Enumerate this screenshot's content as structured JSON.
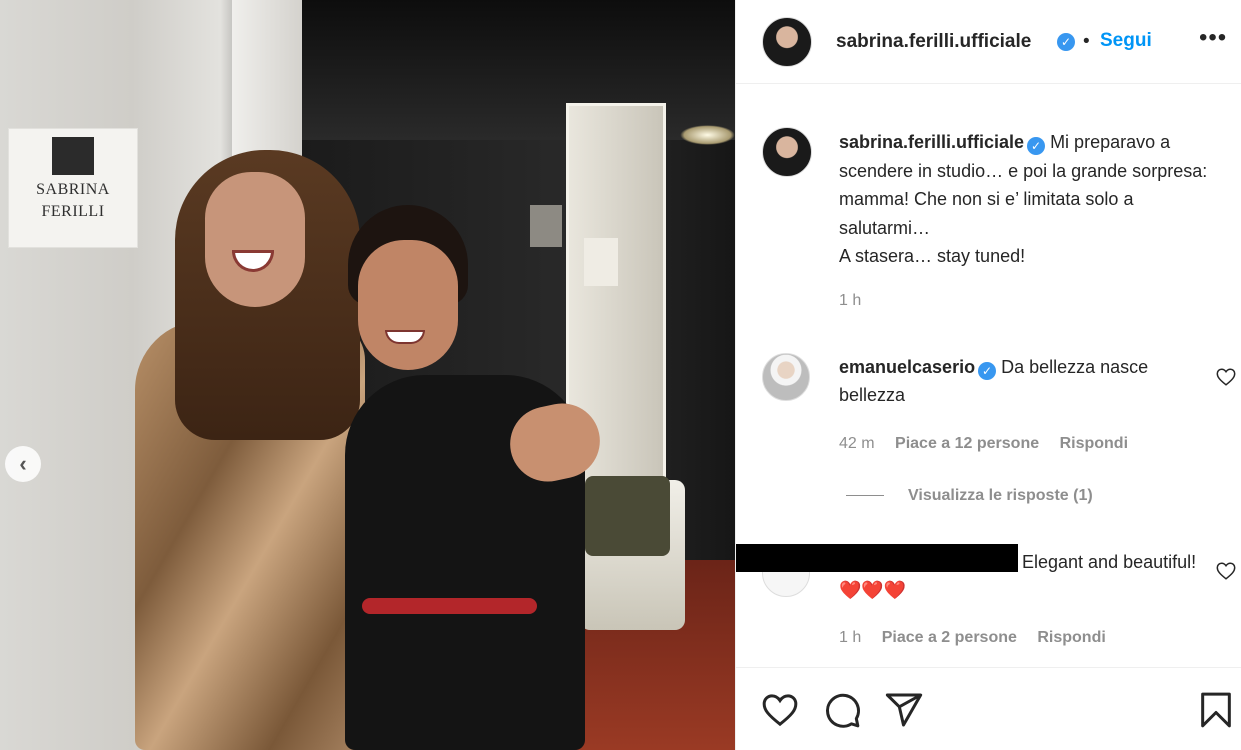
{
  "photo": {
    "nameplate_lines": [
      "SABRINA",
      "FERILLI"
    ],
    "prev_glyph": "‹"
  },
  "post": {
    "username": "sabrina.ferilli.ufficiale",
    "separator": "•",
    "follow_label": "Segui",
    "more_glyph": "•••",
    "verified_glyph": "✓"
  },
  "caption": {
    "username": "sabrina.ferilli.ufficiale",
    "text_line1": " Mi preparavo a scendere in studio… e poi la grande sorpresa: mamma! Che non si e’ limitata solo a salutarmi…",
    "text_line2": "A stasera… stay tuned!",
    "time": "1 h"
  },
  "comments": [
    {
      "username": "emanuelcaserio",
      "text": " Da bellezza nasce bellezza",
      "time": "42 m",
      "likes": "Piace a 12 persone",
      "reply": "Rispondi"
    },
    {
      "username": "",
      "text": "Elegant and beautiful! ❤️❤️❤️",
      "time": "1 h",
      "likes": "Piace a 2 persone",
      "reply": "Rispondi"
    }
  ],
  "view_replies": "Visualizza le risposte (1)",
  "colors": {
    "link": "#0095f6",
    "verified": "#3897f0",
    "meta": "#8e8e8e",
    "heart_red": "#ed4956"
  },
  "icons": [
    "heart-icon",
    "comment-icon",
    "share-icon",
    "bookmark-icon"
  ]
}
